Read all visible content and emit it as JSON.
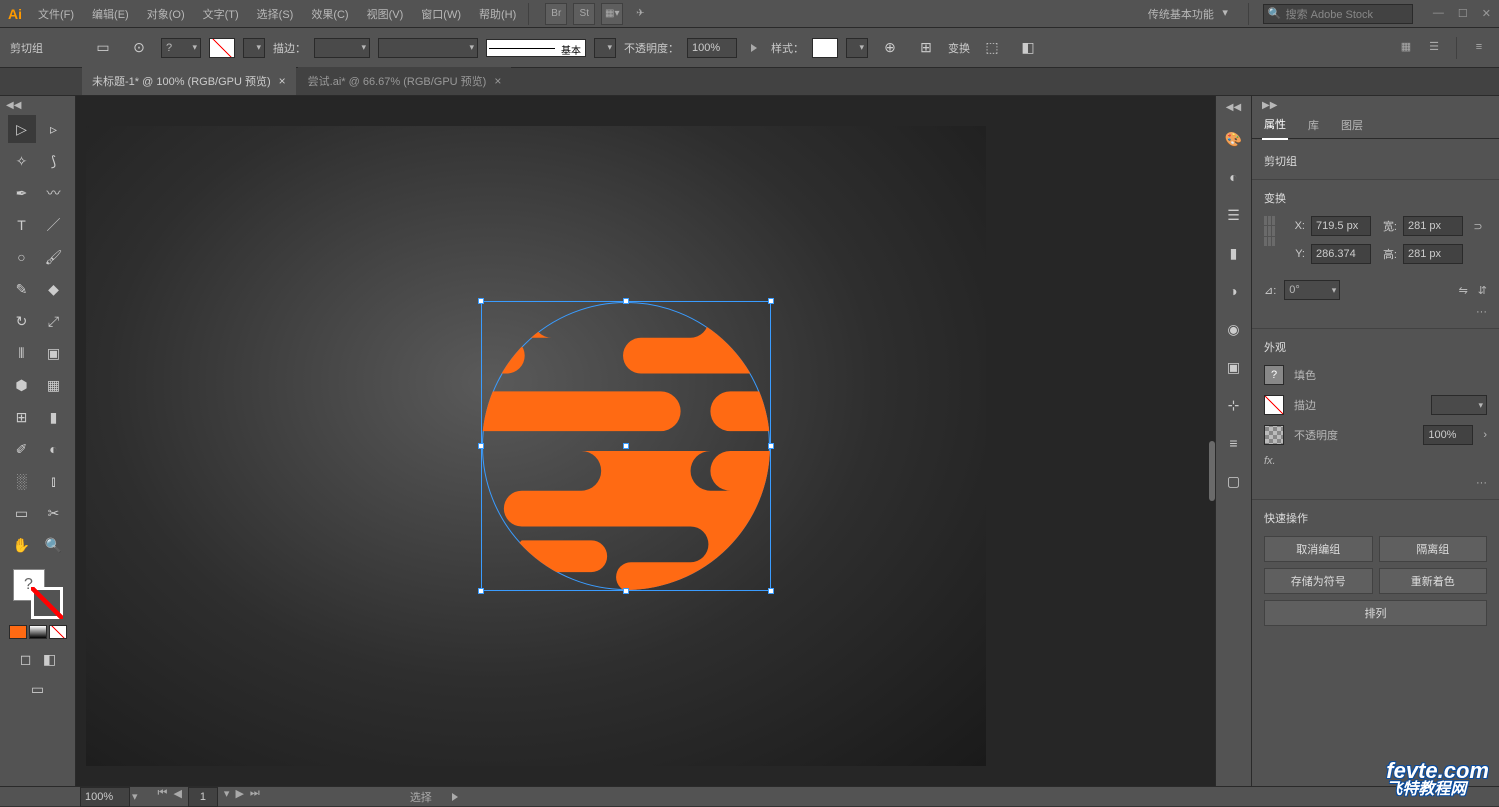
{
  "menu": {
    "items": [
      "文件(F)",
      "编辑(E)",
      "对象(O)",
      "文字(T)",
      "选择(S)",
      "效果(C)",
      "视图(V)",
      "窗口(W)",
      "帮助(H)"
    ],
    "br": "Br",
    "st": "St",
    "workspace": "传统基本功能",
    "search_ph": "搜索 Adobe Stock"
  },
  "selection_label": "剪切组",
  "control": {
    "stroke_label": "描边：",
    "basic_label": "基本",
    "opacity_label": "不透明度：",
    "opacity_val": "100%",
    "style_label": "样式：",
    "transform_label": "变换"
  },
  "tabs": [
    {
      "title": "未标题-1* @ 100% (RGB/GPU 预览)",
      "active": true
    },
    {
      "title": "尝试.ai* @ 66.67% (RGB/GPU 预览)",
      "active": false
    }
  ],
  "panel": {
    "tabs": [
      "属性",
      "库",
      "图层"
    ],
    "object_type": "剪切组",
    "transform_head": "变换",
    "x_lbl": "X:",
    "x_val": "719.5 px",
    "w_lbl": "宽:",
    "w_val": "281 px",
    "y_lbl": "Y:",
    "y_val": "286.374",
    "h_lbl": "高:",
    "h_val": "281 px",
    "angle_lbl": "⊿:",
    "angle_val": "0°",
    "appearance_head": "外观",
    "fill_lbl": "填色",
    "stroke_lbl": "描边",
    "opacity_lbl": "不透明度",
    "opacity_val": "100%",
    "fx": "fx.",
    "actions_head": "快速操作",
    "btn_ungroup": "取消编组",
    "btn_isolate": "隔离组",
    "btn_symbol": "存储为符号",
    "btn_recolor": "重新着色",
    "btn_arrange": "排列"
  },
  "status": {
    "zoom": "100%",
    "artboard": "1",
    "mode": "选择"
  },
  "colors": {
    "orange": "#ff6a13"
  },
  "watermark": {
    "en": "fevte.com",
    "cn": "飞特教程网"
  }
}
